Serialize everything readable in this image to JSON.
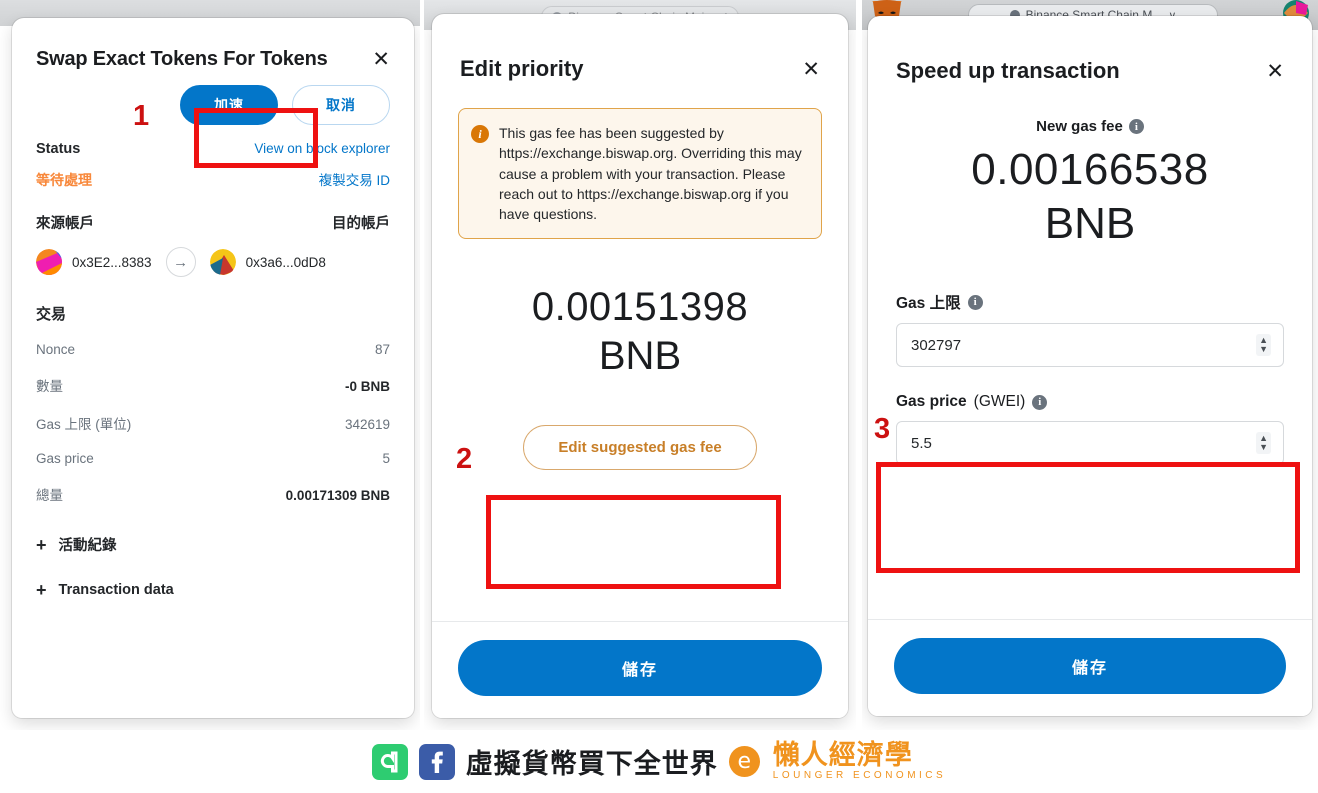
{
  "panel1": {
    "title": "Swap Exact Tokens For Tokens",
    "close": "✕",
    "speed_up_label": "加速",
    "cancel_label": "取消",
    "status_label": "Status",
    "explorer_link": "View on block explorer",
    "status_value": "等待處理",
    "copy_tx_link": "複製交易 ID",
    "from_label": "來源帳戶",
    "to_label": "目的帳戶",
    "from_address": "0x3E2...8383",
    "to_address": "0x3a6...0dD8",
    "arrow_icon": "→",
    "section_title": "交易",
    "rows": [
      {
        "label": "Nonce",
        "value": "87",
        "bold": false
      },
      {
        "label": "數量",
        "value": "-0 BNB",
        "bold": true
      },
      {
        "label": "Gas 上限 (單位)",
        "value": "342619",
        "bold": false
      },
      {
        "label": "Gas price",
        "value": "5",
        "bold": false
      },
      {
        "label": "總量",
        "value": "0.00171309 BNB",
        "bold": true
      }
    ],
    "expanders": [
      {
        "plus": "+",
        "label": "活動紀錄"
      },
      {
        "plus": "+",
        "label": "Transaction data"
      }
    ],
    "marker": "1"
  },
  "panel2": {
    "chrome_network": "Binance Smart Chain Mainnet",
    "title": "Edit priority",
    "close": "✕",
    "notice_icon": "i",
    "notice_text": "This gas fee has been suggested by https://exchange.biswap.org. Overriding this may cause a problem with your transaction. Please reach out to https://exchange.biswap.org if you have questions.",
    "fee_amount": "0.00151398",
    "fee_currency": "BNB",
    "edit_gas_label": "Edit suggested gas fee",
    "save_label": "儲存",
    "marker": "2"
  },
  "panel3": {
    "chrome_network": "Binance Smart Chain M...",
    "chrome_caret": "∨",
    "title": "Speed up transaction",
    "close": "✕",
    "new_gas_fee_label": "New gas fee",
    "info_icon": "i",
    "fee_amount": "0.00166538",
    "fee_currency": "BNB",
    "gas_limit_label": "Gas 上限",
    "gas_limit_value": "302797",
    "gas_price_label": "Gas price",
    "gas_price_unit": "(GWEI)",
    "gas_price_value": "5.5",
    "spinner_up": "▲",
    "spinner_down": "▼",
    "save_label": "儲存",
    "marker": "3"
  },
  "footer": {
    "line_glyph": "a",
    "facebook_glyph": "f",
    "slogan": "虛擬貨幣買下全世界",
    "le_glyph": "e",
    "brand_cn": "懶人經濟學",
    "brand_en": "LOUNGER ECONOMICS"
  },
  "colors": {
    "primary_blue": "#0376c9",
    "highlight_red": "#ee1111",
    "pending_orange": "#f8883b",
    "notice_border": "#e0a44a",
    "brand_orange": "#f0931e"
  }
}
